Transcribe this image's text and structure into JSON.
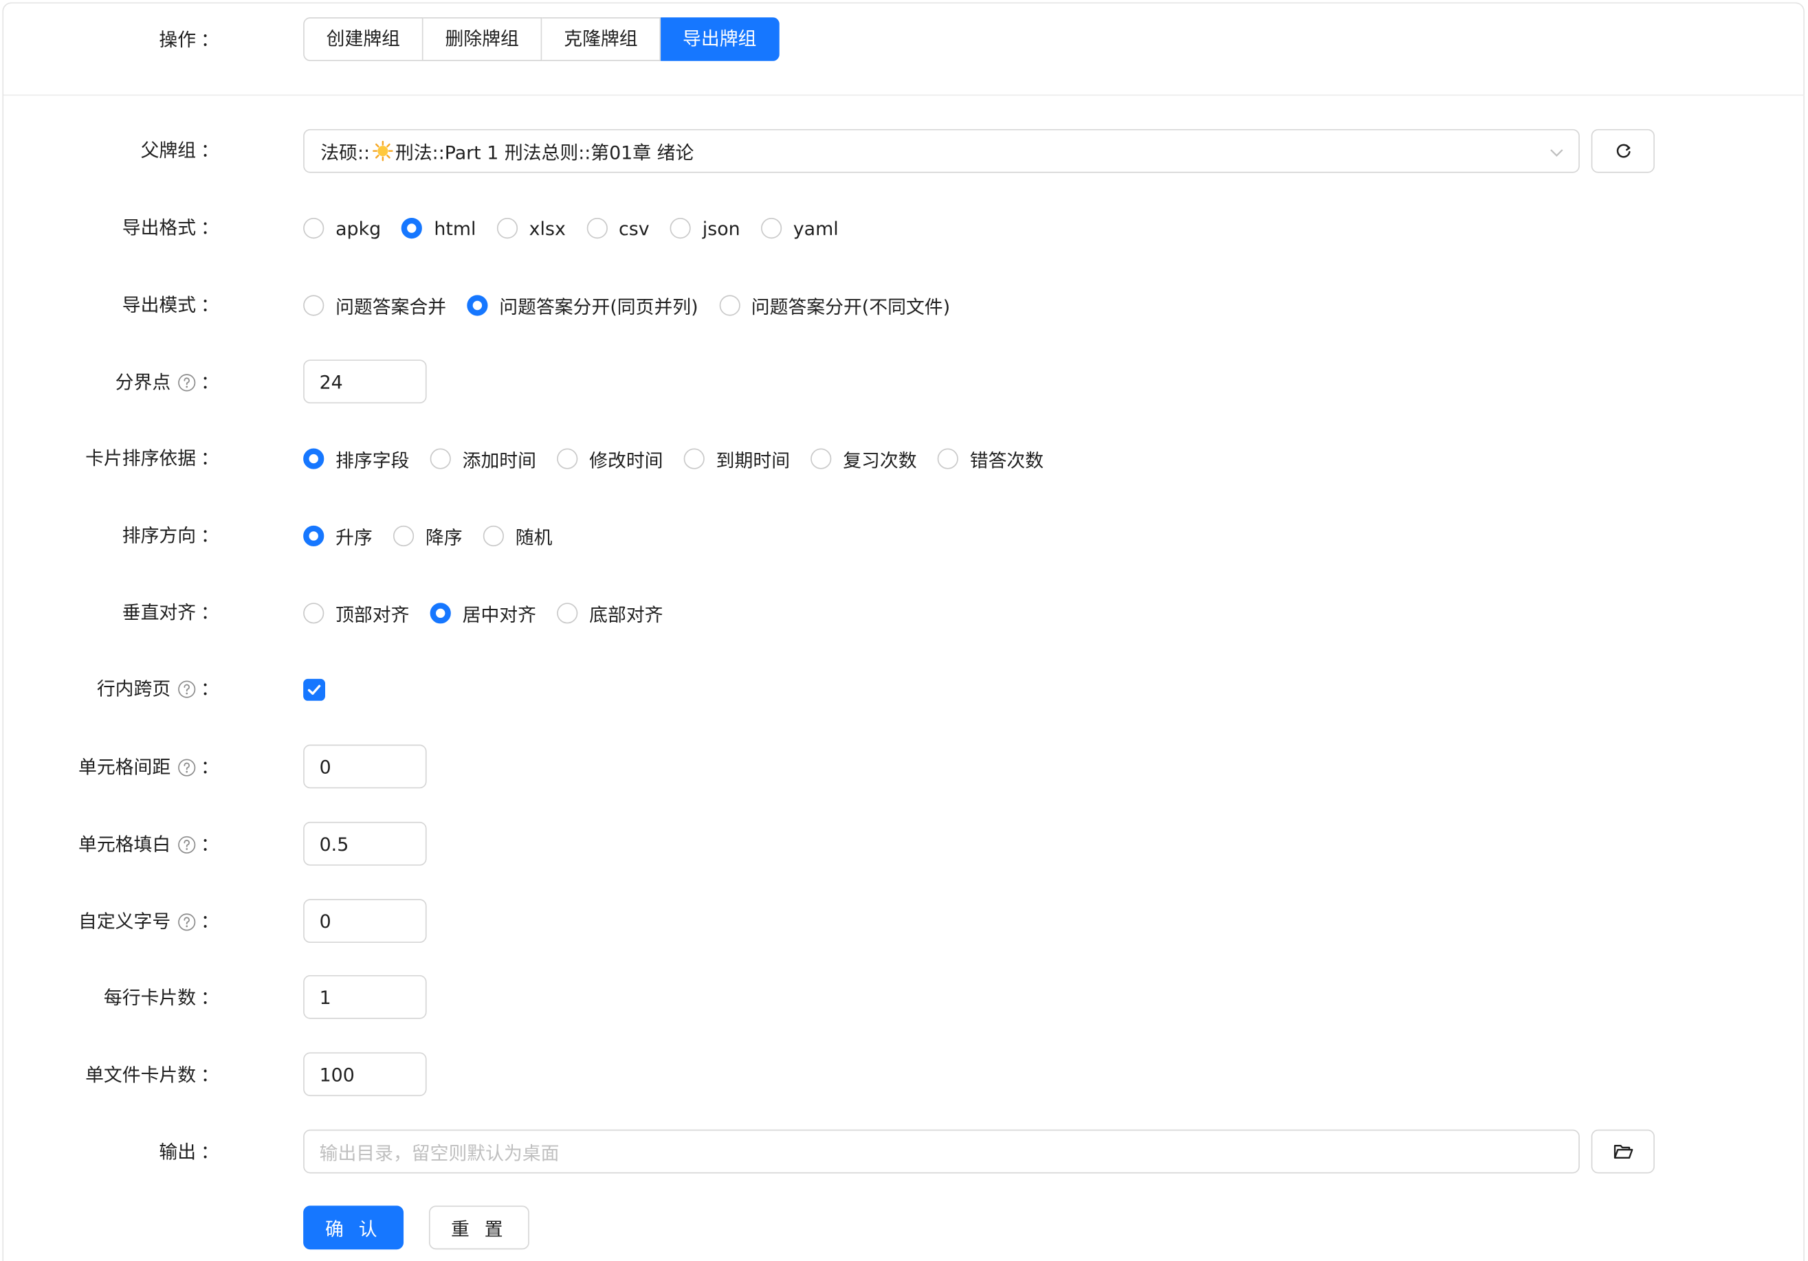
{
  "operation": {
    "label": "操作",
    "buttons": [
      "创建牌组",
      "删除牌组",
      "克隆牌组",
      "导出牌组"
    ],
    "active_index": 3
  },
  "parent_deck": {
    "label": "父牌组",
    "value_prefix": "法硕::",
    "value_suffix": "刑法::Part 1 刑法总则::第01章 绪论"
  },
  "export_format": {
    "label": "导出格式",
    "options": [
      "apkg",
      "html",
      "xlsx",
      "csv",
      "json",
      "yaml"
    ],
    "selected": "html"
  },
  "export_mode": {
    "label": "导出模式",
    "options": [
      "问题答案合并",
      "问题答案分开(同页并列)",
      "问题答案分开(不同文件)"
    ],
    "selected": "问题答案分开(同页并列)"
  },
  "split_point": {
    "label": "分界点",
    "value": "24"
  },
  "sort_by": {
    "label": "卡片排序依据",
    "options": [
      "排序字段",
      "添加时间",
      "修改时间",
      "到期时间",
      "复习次数",
      "错答次数"
    ],
    "selected": "排序字段"
  },
  "sort_direction": {
    "label": "排序方向",
    "options": [
      "升序",
      "降序",
      "随机"
    ],
    "selected": "升序"
  },
  "vertical_align": {
    "label": "垂直对齐",
    "options": [
      "顶部对齐",
      "居中对齐",
      "底部对齐"
    ],
    "selected": "居中对齐"
  },
  "inline_page_break": {
    "label": "行内跨页",
    "checked": true
  },
  "cell_spacing": {
    "label": "单元格间距",
    "value": "0"
  },
  "cell_padding": {
    "label": "单元格填白",
    "value": "0.5"
  },
  "custom_font_size": {
    "label": "自定义字号",
    "value": "0"
  },
  "cards_per_row": {
    "label": "每行卡片数",
    "value": "1"
  },
  "cards_per_file": {
    "label": "单文件卡片数",
    "value": "100"
  },
  "output": {
    "label": "输出",
    "placeholder": "输出目录，留空则默认为桌面"
  },
  "actions": {
    "confirm": "确 认",
    "reset": "重 置"
  },
  "colon": "：",
  "colors": {
    "primary": "#1677ff",
    "border": "#d6d6d6",
    "placeholder": "#bfbfbf"
  },
  "icons": {
    "help": "question-circle-icon",
    "refresh": "refresh-icon",
    "folder": "folder-open-icon",
    "chevron": "chevron-down-icon",
    "sun": "sun-emoji-icon"
  }
}
